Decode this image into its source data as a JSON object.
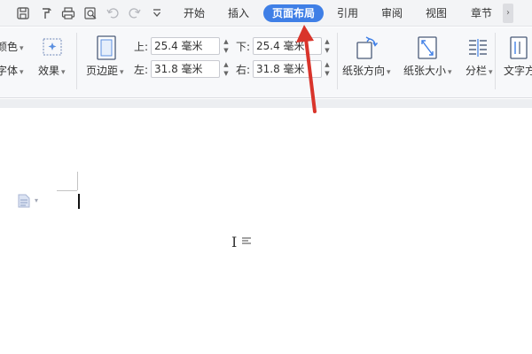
{
  "quick_access": {
    "icons": [
      "save-icon",
      "format-painter-icon",
      "print-icon",
      "print-preview-icon",
      "undo-icon",
      "redo-icon",
      "customize-dropdown-icon"
    ]
  },
  "tabs": [
    {
      "label": "开始",
      "active": false
    },
    {
      "label": "插入",
      "active": false
    },
    {
      "label": "页面布局",
      "active": true
    },
    {
      "label": "引用",
      "active": false
    },
    {
      "label": "审阅",
      "active": false
    },
    {
      "label": "视图",
      "active": false
    },
    {
      "label": "章节",
      "active": false
    }
  ],
  "ribbon": {
    "theme_colors_label": "颜色",
    "theme_fonts_label": "字体",
    "effects_label": "效果",
    "margins_label": "页边距",
    "margin_top_label": "上:",
    "margin_top_value": "25.4 毫米",
    "margin_bottom_label": "下:",
    "margin_bottom_value": "25.4 毫米",
    "margin_left_label": "左:",
    "margin_left_value": "31.8 毫米",
    "margin_right_label": "右:",
    "margin_right_value": "31.8 毫米",
    "orientation_label": "纸张方向",
    "size_label": "纸张大小",
    "columns_label": "分栏",
    "text_direction_label": "文字方"
  },
  "document": {
    "cursor_visible": true
  },
  "annotation": {
    "arrow_color": "#d9342b"
  },
  "colors": {
    "active_tab": "#3f7fe6",
    "ribbon_bg": "#f7f8fa",
    "menubar_bg": "#f3f4f6"
  }
}
